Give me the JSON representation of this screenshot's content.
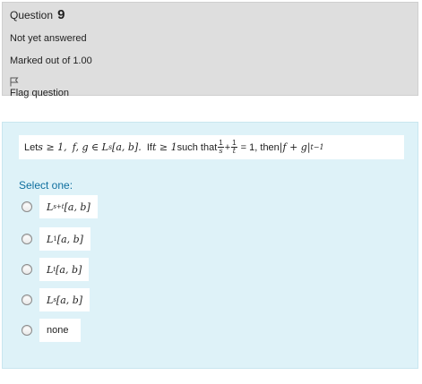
{
  "info": {
    "question_word": "Question",
    "question_number": "9",
    "status": "Not yet answered",
    "marks": "Marked out of 1.00",
    "flag_label": "Flag question"
  },
  "question": {
    "stem_prefix": "Let ",
    "stem_cond1": "s ≥ 1,",
    "stem_vars": "f, g ∈ L",
    "stem_vars_sup": "s",
    "stem_space": "[a, b].",
    "stem_if": "If ",
    "stem_cond2": "t ≥ 1",
    "stem_mid": " such that ",
    "frac1_num": "1",
    "frac1_den": "s",
    "plus": "+",
    "frac2_num": "1",
    "frac2_den": "t",
    "stem_eq": "= 1, then ",
    "stem_abs": "|f + g|",
    "stem_abs_sup": "t−1",
    "prompt": "Select one:"
  },
  "options": [
    {
      "base": "L",
      "sup": "s+t",
      "rest": "[a, b]"
    },
    {
      "base": "L",
      "sup": "1",
      "rest": "[a, b]"
    },
    {
      "base": "L",
      "sup": "t",
      "rest": "[a, b]"
    },
    {
      "base": "L",
      "sup": "s",
      "rest": "[a, b]"
    },
    {
      "text": "none"
    }
  ]
}
